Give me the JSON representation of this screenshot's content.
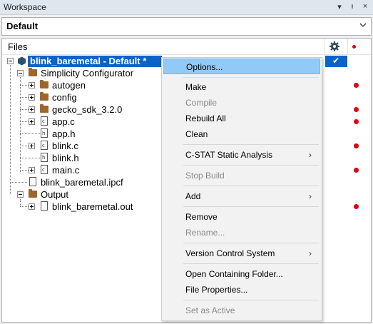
{
  "window": {
    "title": "Workspace",
    "controls": [
      "▾",
      "ᵻ",
      "×"
    ]
  },
  "config": {
    "selected": "Default"
  },
  "tree_header": {
    "files_label": "Files",
    "columns": [
      "gear-icon",
      "red-dot-icon"
    ]
  },
  "tree": {
    "project": "blink_baremetal - Default *",
    "project_check": "✔",
    "simplicity": "Simplicity Configurator",
    "autogen": "autogen",
    "config": "config",
    "gecko": "gecko_sdk_3.2.0",
    "appc": "app.c",
    "apph": "app.h",
    "blinkc": "blink.c",
    "blinkh": "blink.h",
    "mainc": "main.c",
    "ipcf": "blink_baremetal.ipcf",
    "output": "Output",
    "outfile": "blink_baremetal.out",
    "file_tag_c": "c",
    "file_tag_h": "h"
  },
  "context_menu": {
    "options": "Options...",
    "make": "Make",
    "compile": "Compile",
    "rebuild": "Rebuild All",
    "clean": "Clean",
    "cstat": "C-STAT Static Analysis",
    "stop": "Stop Build",
    "add": "Add",
    "remove": "Remove",
    "rename": "Rename...",
    "vcs": "Version Control System",
    "open_folder": "Open Containing Folder...",
    "file_props": "File Properties...",
    "set_active": "Set as Active",
    "submenu_arrow": "›"
  },
  "colors": {
    "selection": "#0a63c9",
    "menu_highlight": "#91c9f7",
    "error_dot": "#e0000f",
    "folder": "#a0652a"
  }
}
